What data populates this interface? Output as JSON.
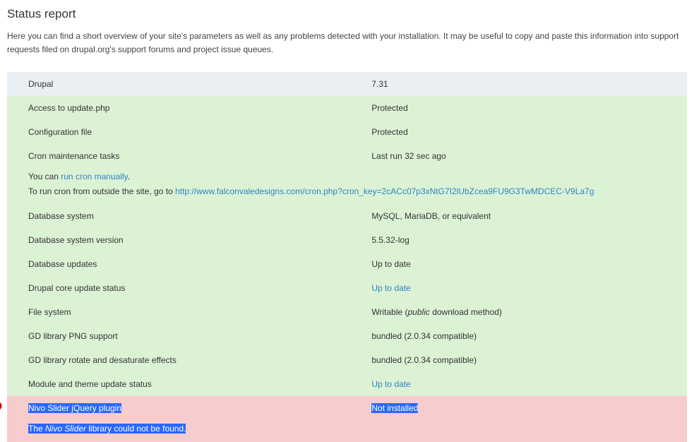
{
  "page_title": "Status report",
  "intro": "Here you can find a short overview of your site's parameters as well as any problems detected with your installation. It may be useful to copy and paste this information into support requests filed on drupal.org's support forums and project issue queues.",
  "rows": {
    "drupal": {
      "label": "Drupal",
      "value": "7.31"
    },
    "update_access": {
      "label": "Access to update.php",
      "value": "Protected"
    },
    "config_file": {
      "label": "Configuration file",
      "value": "Protected"
    },
    "cron": {
      "label": "Cron maintenance tasks",
      "value": "Last run 32 sec ago"
    },
    "cron_note_pre": "You can ",
    "cron_link1": "run cron manually",
    "cron_note_post": ".",
    "cron_note2_pre": "To run cron from outside the site, go to ",
    "cron_link2": "http://www.falconvaledesigns.com/cron.php?cron_key=2cACc07p3xNtG7I2lUbZcea9FU9G3TwMDCEC-V9La7g",
    "db_system": {
      "label": "Database system",
      "value": "MySQL, MariaDB, or equivalent"
    },
    "db_version": {
      "label": "Database system version",
      "value": "5.5.32-log"
    },
    "db_updates": {
      "label": "Database updates",
      "value": "Up to date"
    },
    "core_update": {
      "label": "Drupal core update status",
      "value_link": "Up to date"
    },
    "file_system": {
      "label": "File system",
      "value_pre": "Writable (",
      "value_em": "public",
      "value_post": " download method)"
    },
    "gd_png": {
      "label": "GD library PNG support",
      "value": "bundled (2.0.34 compatible)"
    },
    "gd_rotate": {
      "label": "GD library rotate and desaturate effects",
      "value": "bundled (2.0.34 compatible)"
    },
    "module_update": {
      "label": "Module and theme update status",
      "value_link": "Up to date"
    },
    "nivo": {
      "label": "Nivo Slider jQuery plugin",
      "value": "Not installed"
    },
    "nivo_note_pre": "The ",
    "nivo_note_em": "Nivo Slider",
    "nivo_note_post": " library could not be found."
  }
}
